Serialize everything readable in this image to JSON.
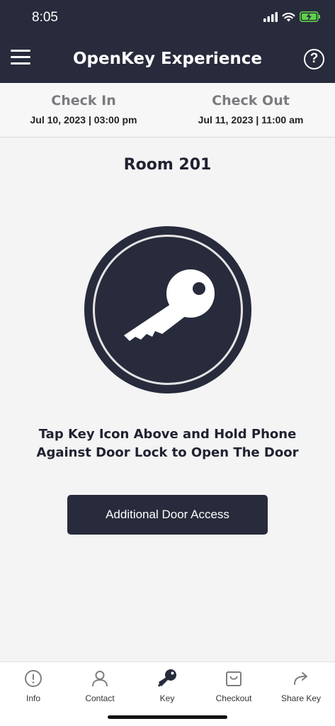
{
  "status_bar": {
    "time": "8:05"
  },
  "header": {
    "title": "OpenKey Experience",
    "help_label": "?"
  },
  "stay": {
    "check_in_label": "Check In",
    "check_in_date": "Jul 10, 2023 | 03:00 pm",
    "check_out_label": "Check Out",
    "check_out_date": "Jul 11, 2023 | 11:00 am"
  },
  "room": {
    "title": "Room 201"
  },
  "instruction": "Tap Key Icon Above and Hold Phone Against Door Lock to Open The Door",
  "door_access_button": "Additional Door Access",
  "tabbar": {
    "items": [
      {
        "label": "Info",
        "icon": "info-icon"
      },
      {
        "label": "Contact",
        "icon": "person-icon"
      },
      {
        "label": "Key",
        "icon": "key-icon"
      },
      {
        "label": "Checkout",
        "icon": "bag-icon"
      },
      {
        "label": "Share Key",
        "icon": "share-icon"
      }
    ]
  },
  "colors": {
    "primary": "#272b3b",
    "background": "#f4f4f5",
    "muted_label": "#7b7b7f",
    "battery_green": "#5fd04a"
  }
}
